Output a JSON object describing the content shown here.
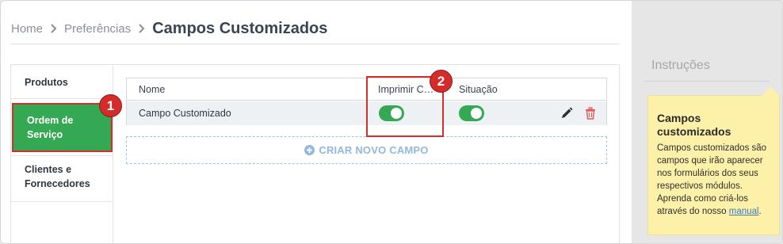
{
  "breadcrumb": {
    "home": "Home",
    "preferences": "Preferências",
    "current": "Campos Customizados"
  },
  "nav": {
    "items": [
      {
        "label": "Produtos",
        "active": false
      },
      {
        "label": "Ordem de Serviço",
        "active": true
      },
      {
        "label": "Clientes e Fornecedores",
        "active": false
      }
    ]
  },
  "table": {
    "columns": {
      "name": "Nome",
      "print": "Imprimir C…",
      "status": "Situação"
    },
    "rows": [
      {
        "name": "Campo Customizado",
        "print": true,
        "status": true
      }
    ]
  },
  "add_field": {
    "label": "CRIAR NOVO CAMPO",
    "icon": "plus-circle-icon"
  },
  "annotations": {
    "badge1": "1",
    "badge2": "2",
    "color": "#d32f2f"
  },
  "instructions": {
    "title": "Instruções",
    "tip_title": "Campos customizados",
    "tip_body": "Campos customizados são campos que irão aparecer nos formulários dos seus respectivos módulos. Aprenda como criá-los através do nosso",
    "tip_link": "manual",
    "tip_end": "."
  },
  "colors": {
    "green": "#34a853",
    "accent_blue": "#8fb9dd",
    "tip_bg": "#fdf0a8",
    "delete_red": "#e05a5a"
  }
}
